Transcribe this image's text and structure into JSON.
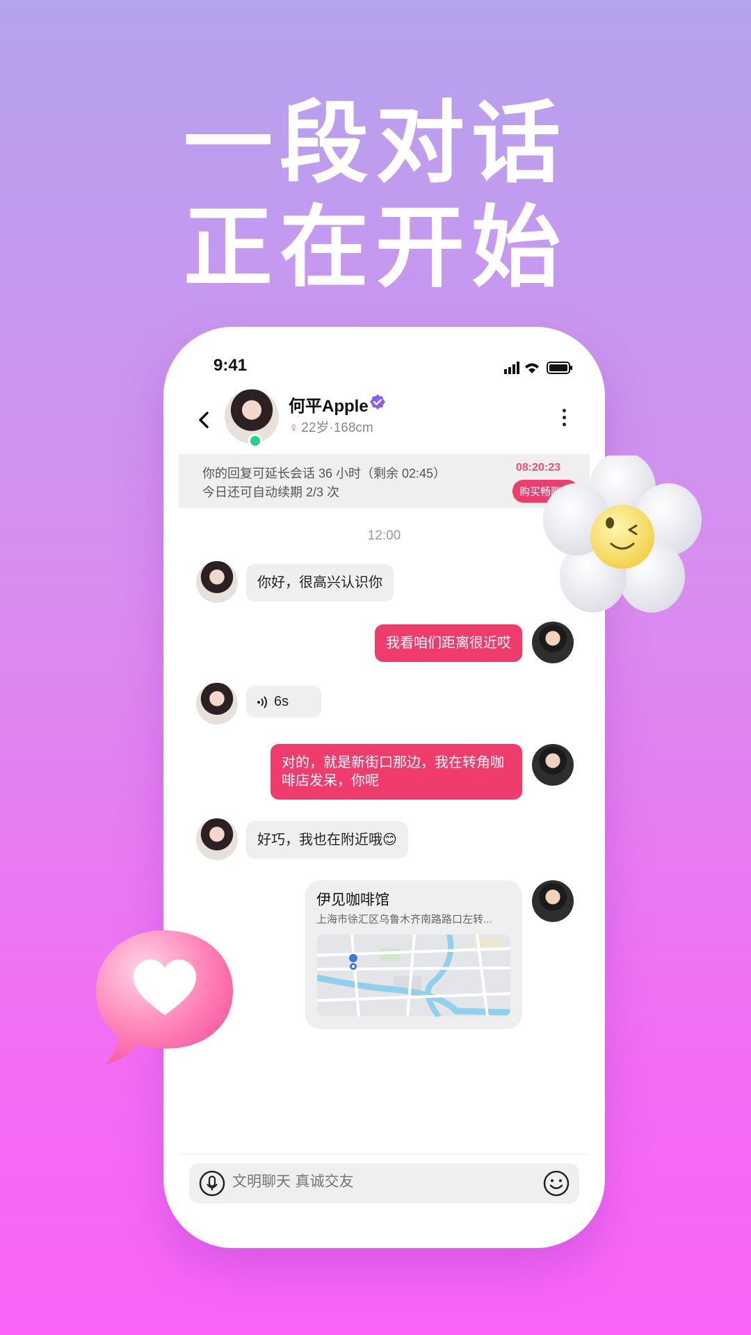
{
  "headline": {
    "line1": "一段对话",
    "line2": "正在开始"
  },
  "status_bar": {
    "time": "9:41"
  },
  "header": {
    "name": "何平Apple",
    "age_height": "22岁·168cm"
  },
  "notice": {
    "line1": "你的回复可延长会话 36 小时（剩余 02:45）",
    "line2": "今日还可自动续期 2/3 次",
    "timer": "08:20:23",
    "buy_label": "购买畅聊卡"
  },
  "chat": {
    "time": "12:00",
    "messages": [
      {
        "side": "in",
        "text": "你好，很高兴认识你"
      },
      {
        "side": "out",
        "text": "我看咱们距离很近哎"
      },
      {
        "side": "in",
        "type": "voice",
        "text": "6s"
      },
      {
        "side": "out",
        "text": "对的，就是新街口那边，我在转角咖啡店发呆，你呢"
      },
      {
        "side": "in",
        "text": "好巧，我也在附近哦😊"
      },
      {
        "side": "out",
        "type": "location",
        "title": "伊见咖啡馆",
        "address": "上海市徐汇区乌鲁木齐南路路口左转..."
      }
    ]
  },
  "input": {
    "placeholder": "文明聊天 真诚交友"
  },
  "colors": {
    "accent": "#f03b6d",
    "online": "#1ed28a",
    "verified": "#8b5cf6"
  }
}
